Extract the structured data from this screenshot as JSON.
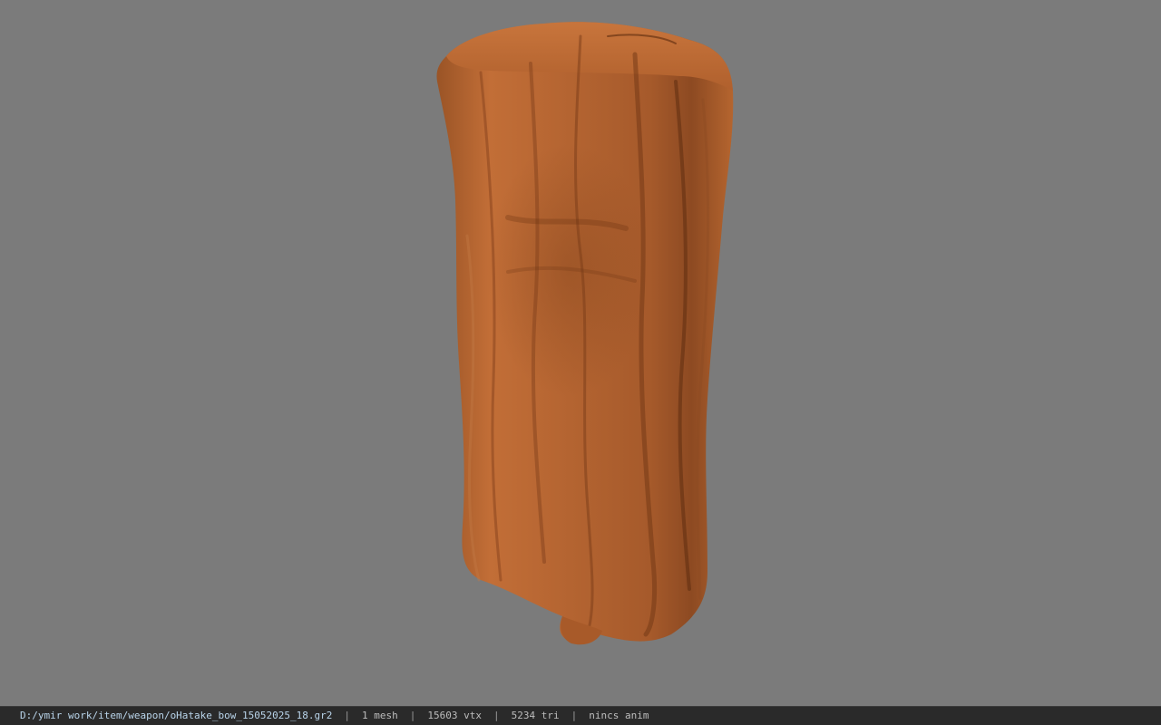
{
  "viewer": {
    "background_color": "#7b7b7b",
    "model_color": "#b8652d",
    "model_name": "wood-log-model"
  },
  "statusbar": {
    "file_path": "D:/ymir work/item/weapon/oHatake_bow_15052025_18.gr2",
    "mesh_count": "1 mesh",
    "vertex_count": "15603 vtx",
    "triangle_count": "5234 tri",
    "animation": "nincs anim",
    "separator": "|"
  }
}
